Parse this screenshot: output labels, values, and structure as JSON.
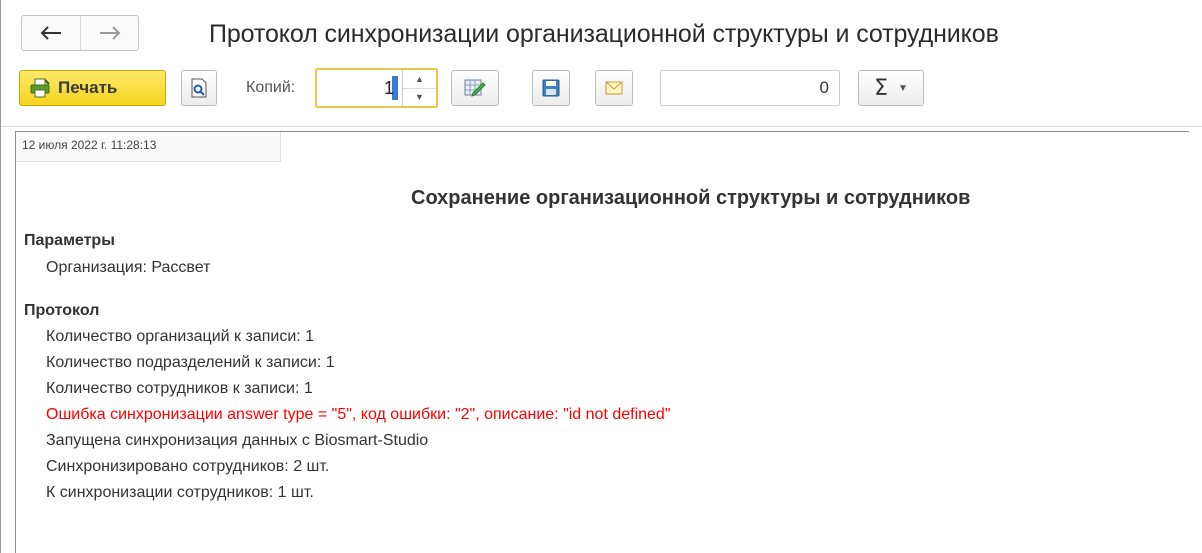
{
  "window": {
    "title": "Протокол синхронизации организационной структуры и сотрудников"
  },
  "toolbar": {
    "print_label": "Печать",
    "copies_label": "Копий:",
    "copies_value": "1",
    "number_value": "0",
    "sum_label": "Σ"
  },
  "report": {
    "timestamp": "12 июля 2022 г. 11:28:13",
    "title": "Сохранение организационной структуры и сотрудников",
    "params_heading": "Параметры",
    "organization": "Организация: Рассвет",
    "protocol_heading": "Протокол",
    "lines": [
      "Количество организаций к записи: 1",
      "Количество подразделений к записи: 1",
      "Количество сотрудников к записи: 1",
      "Ошибка синхронизации answer type = \"5\", код ошибки: \"2\", описание: \"id not defined\"",
      "Запущена синхронизация данных с Biosmart-Studio",
      "Синхронизировано сотрудников: 2 шт.",
      "К синхронизации сотрудников: 1 шт."
    ],
    "error_color": "#ff0000"
  },
  "icons": {
    "back": "arrow-left-icon",
    "forward": "arrow-right-icon",
    "print": "printer-icon",
    "preview": "preview-icon",
    "edit": "edit-icon",
    "save": "floppy-disk-icon",
    "email": "envelope-icon",
    "dropdown": "chevron-down-icon"
  }
}
